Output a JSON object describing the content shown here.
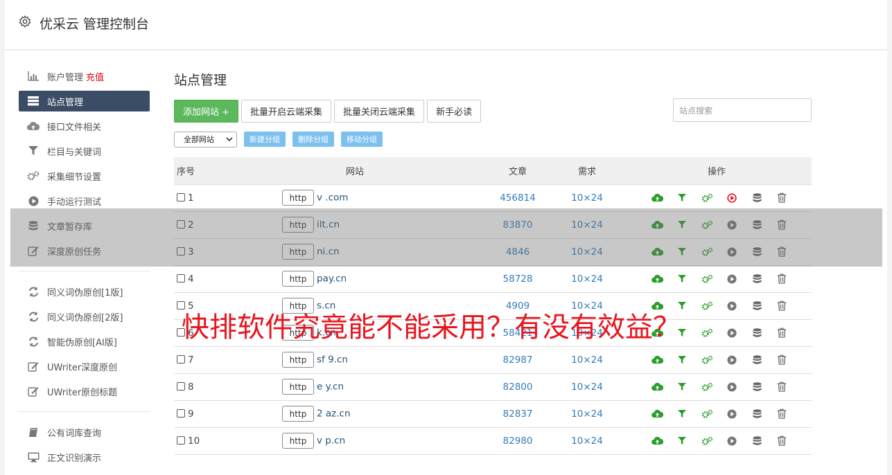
{
  "header": {
    "title": "优采云 管理控制台",
    "icon": "gear-icon"
  },
  "sidebar": {
    "items": [
      {
        "label": "账户管理",
        "extra": "充值",
        "icon": "bar-chart-icon"
      },
      {
        "label": "站点管理",
        "icon": "server-list-icon",
        "active": true
      },
      {
        "label": "接口文件相关",
        "icon": "cloud-upload-icon"
      },
      {
        "label": "栏目与关键词",
        "icon": "filter-icon"
      },
      {
        "label": "采集细节设置",
        "icon": "gears-icon"
      },
      {
        "label": "手动运行测试",
        "icon": "play-circle-icon"
      },
      {
        "label": "文章暂存库",
        "icon": "database-icon"
      },
      {
        "label": "深度原创任务",
        "icon": "edit-icon"
      }
    ],
    "items2": [
      {
        "label": "同义词伪原创[1版]",
        "icon": "refresh-icon"
      },
      {
        "label": "同义词伪原创[2版]",
        "icon": "refresh-icon"
      },
      {
        "label": "智能伪原创[AI版]",
        "icon": "refresh-icon"
      },
      {
        "label": "UWriter深度原创",
        "icon": "edit-icon"
      },
      {
        "label": "UWriter原创标题",
        "icon": "edit-icon"
      }
    ],
    "items3": [
      {
        "label": "公有词库查询",
        "icon": "book-icon"
      },
      {
        "label": "正文识别演示",
        "icon": "monitor-icon"
      }
    ]
  },
  "main": {
    "title": "站点管理",
    "buttons": {
      "add": "添加网站 +",
      "batch_open": "批量开启云端采集",
      "batch_close": "批量关闭云端采集",
      "guide": "新手必读"
    },
    "search_placeholder": "站点搜索",
    "group_select": "全部网站",
    "group_buttons": {
      "new": "新建分组",
      "delete": "删除分组",
      "move": "移动分组"
    },
    "table": {
      "headers": [
        "序号",
        "网站",
        "文章",
        "需求",
        "操作"
      ],
      "rows": [
        {
          "no": "1",
          "prefix": "http",
          "site": "v .com",
          "articles": "456814",
          "demand": "10×24",
          "run_active": true
        },
        {
          "no": "2",
          "prefix": "http",
          "site": "ilt.cn",
          "articles": "83870",
          "demand": "10×24"
        },
        {
          "no": "3",
          "prefix": "http",
          "site": "ni.cn",
          "articles": "4846",
          "demand": "10×24"
        },
        {
          "no": "4",
          "prefix": "http",
          "site": "pay.cn",
          "articles": "58728",
          "demand": "10×24"
        },
        {
          "no": "5",
          "prefix": "http",
          "site": "s.cn",
          "articles": "4909",
          "demand": "10×24"
        },
        {
          "no": "6",
          "prefix": "http",
          "site": "k.cn",
          "articles": "58421",
          "demand": "10×24"
        },
        {
          "no": "7",
          "prefix": "http",
          "site": "sf 9.cn",
          "articles": "82987",
          "demand": "10×24"
        },
        {
          "no": "8",
          "prefix": "http",
          "site": "e y.cn",
          "articles": "82800",
          "demand": "10×24"
        },
        {
          "no": "9",
          "prefix": "http",
          "site": "2 az.cn",
          "articles": "82837",
          "demand": "10×24"
        },
        {
          "no": "10",
          "prefix": "http",
          "site": "v p.cn",
          "articles": "82980",
          "demand": "10×24"
        }
      ]
    }
  },
  "overlay_caption": "快排软件究竟能不能采用？有没有效益？",
  "colors": {
    "accent_green": "#5cb85c",
    "sidebar_active": "#3b4c66",
    "link_blue": "#337ab7",
    "caption_red": "#e8141e",
    "icon_green": "#2a9d2a",
    "run_red": "#e60012"
  }
}
